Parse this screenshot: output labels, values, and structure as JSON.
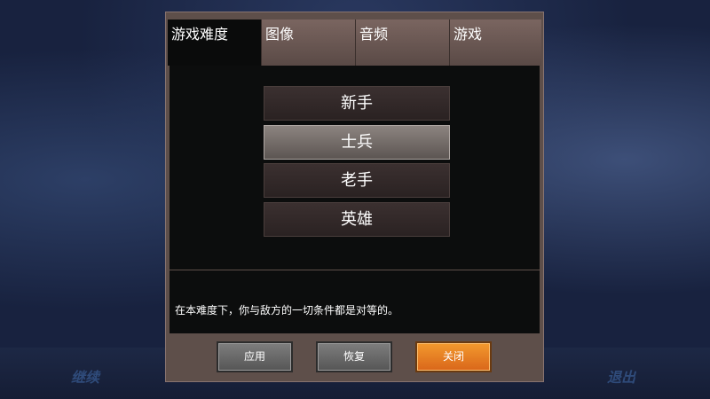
{
  "background": {
    "continue_label": "继续",
    "quit_label": "退出"
  },
  "tabs": [
    {
      "label": "游戏难度",
      "active": true
    },
    {
      "label": "图像",
      "active": false
    },
    {
      "label": "音频",
      "active": false
    },
    {
      "label": "游戏",
      "active": false
    }
  ],
  "difficulty_options": [
    {
      "label": "新手",
      "selected": false
    },
    {
      "label": "士兵",
      "selected": true
    },
    {
      "label": "老手",
      "selected": false
    },
    {
      "label": "英雄",
      "selected": false
    }
  ],
  "description": "在本难度下，你与敌方的一切条件都是对等的。",
  "buttons": {
    "apply": "应用",
    "restore": "恢复",
    "close": "关闭"
  },
  "colors": {
    "close_button": "#e8802a",
    "dialog_frame": "#5e4f4a",
    "panel_background": "#0c0d0d"
  }
}
